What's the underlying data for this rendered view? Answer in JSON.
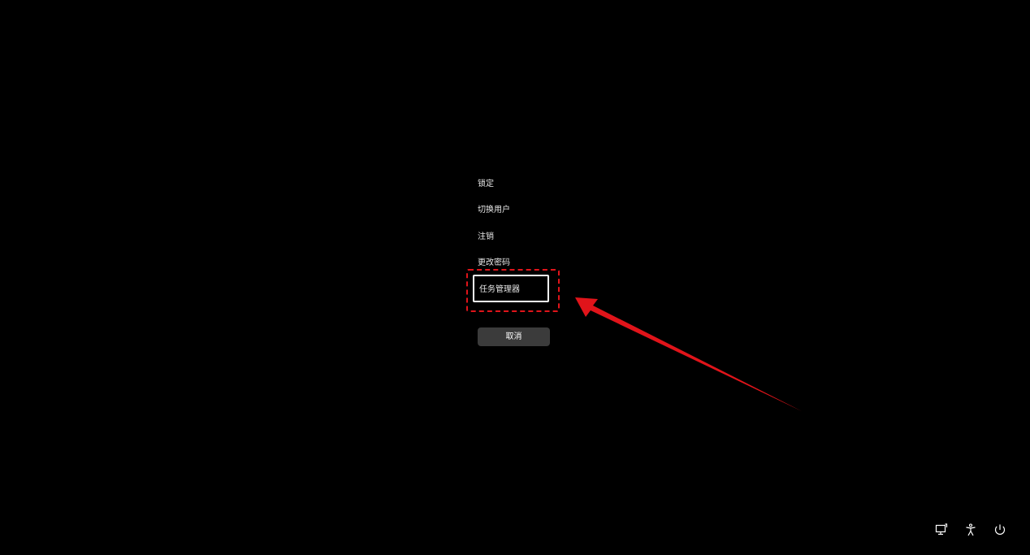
{
  "menu": {
    "items": [
      {
        "label": "锁定"
      },
      {
        "label": "切换用户"
      },
      {
        "label": "注销"
      },
      {
        "label": "更改密码"
      },
      {
        "label": "任务管理器"
      }
    ],
    "cancel_label": "取消"
  },
  "bottom_bar": {
    "icons": [
      "network-icon",
      "accessibility-icon",
      "power-icon"
    ]
  },
  "colors": {
    "background": "#000000",
    "annotation": "#e0141a",
    "button_bg": "#3b3b3b",
    "text": "#ffffff"
  }
}
